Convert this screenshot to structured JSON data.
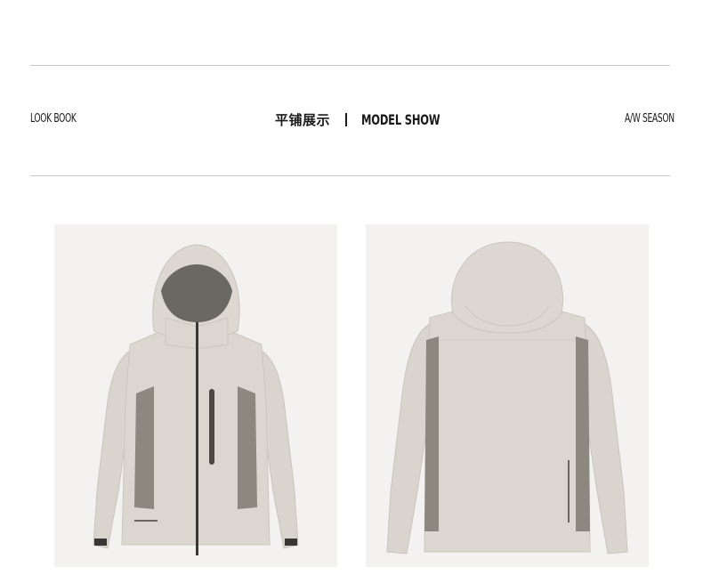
{
  "header": {
    "left_label": "LOOK BOOK",
    "center_title_cn": "平铺展示",
    "center_title_en": "MODEL SHOW",
    "right_label": "A/W SEASON"
  },
  "colors": {
    "rule": "#c8c8c8",
    "jacket_main": "#d9d5ce",
    "jacket_panel": "#8c877f",
    "hood_lining": "#6b6761",
    "photo_bg": "#f3f2f0"
  },
  "images": [
    {
      "name": "jacket-front",
      "icon": "hooded-jacket-front"
    },
    {
      "name": "jacket-back",
      "icon": "hooded-jacket-back"
    }
  ]
}
